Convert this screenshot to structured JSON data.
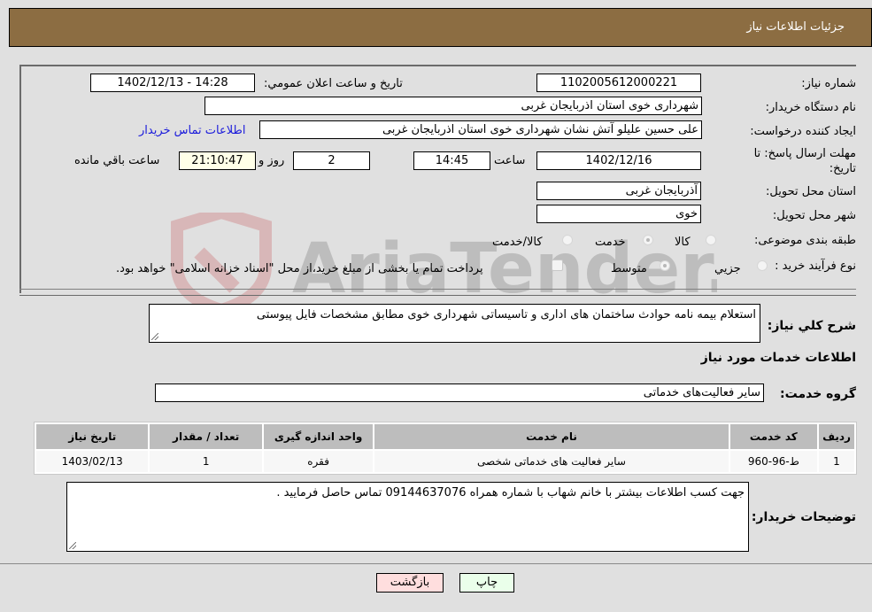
{
  "header": {
    "title": "جزئیات اطلاعات نیاز"
  },
  "form": {
    "need_number": {
      "label": "شماره نیاز:",
      "value": "1102005612000221"
    },
    "announce_datetime": {
      "label": "تاریخ و ساعت اعلان عمومي:",
      "value": "1402/12/13 - 14:28"
    },
    "buyer_org": {
      "label": "نام دستگاه خريدار:",
      "value": "شهرداری خوی استان اذربایجان غربی"
    },
    "requester": {
      "label": "ايجاد کننده درخواست:",
      "value": "علی حسین علیلو آتش نشان شهرداری خوی استان اذربایجان غربی"
    },
    "buyer_contact_link": "اطلاعات تماس خریدار",
    "deadline": {
      "label_line1": "مهلت ارسال پاسخ: تا",
      "label_line2": "تاریخ:",
      "date": "1402/12/16",
      "time_label": "ساعت",
      "time": "14:45",
      "days": "2",
      "days_label": "روز و",
      "remaining": "21:10:47",
      "remaining_label": "ساعت باقي مانده"
    },
    "delivery_province": {
      "label": "استان محل تحويل:",
      "value": "آذربایجان غربی"
    },
    "delivery_city": {
      "label": "شهر محل تحويل:",
      "value": "خوی"
    },
    "category": {
      "label": "طبقه بندی موضوعی:",
      "options": [
        "کالا",
        "خدمت",
        "کالا/خدمت"
      ],
      "selected": "خدمت"
    },
    "purchase_type": {
      "label": "نوع فرآيند خريد :",
      "options": [
        "جزيي",
        "متوسط"
      ],
      "selected": "متوسط",
      "treasury_checkbox_label": "پرداخت تمام یا بخشی از مبلغ خرید،از محل \"اسناد خزانه اسلامی\" خواهد بود.",
      "treasury_checked": false
    }
  },
  "description": {
    "label": "شرح کلي نياز:",
    "value": "استعلام بیمه نامه حوادث ساختمان های اداری و تاسیساتی شهرداری خوی مطابق مشخصات فایل پیوستی"
  },
  "services_section": {
    "title": "اطلاعات خدمات مورد نياز",
    "group_label": "گروه خدمت:",
    "group_value": "سایر فعالیت‌های خدماتی"
  },
  "table": {
    "headers": [
      "رديف",
      "کد خدمت",
      "نام خدمت",
      "واحد اندازه گيری",
      "تعداد / مقدار",
      "تاريخ نياز"
    ],
    "rows": [
      [
        "1",
        "ط-96-960",
        "سایر فعالیت های خدماتی شخصی",
        "فقره",
        "1",
        "1403/02/13"
      ]
    ]
  },
  "buyer_notes": {
    "label": "توضيحات خريدار:",
    "value": "جهت کسب اطلاعات بیشتر با خانم شهاب با شماره همراه 09144637076 تماس حاصل فرمایید ."
  },
  "buttons": {
    "print": "چاپ",
    "back": "بازگشت"
  },
  "watermark": "AriaTender.neT"
}
